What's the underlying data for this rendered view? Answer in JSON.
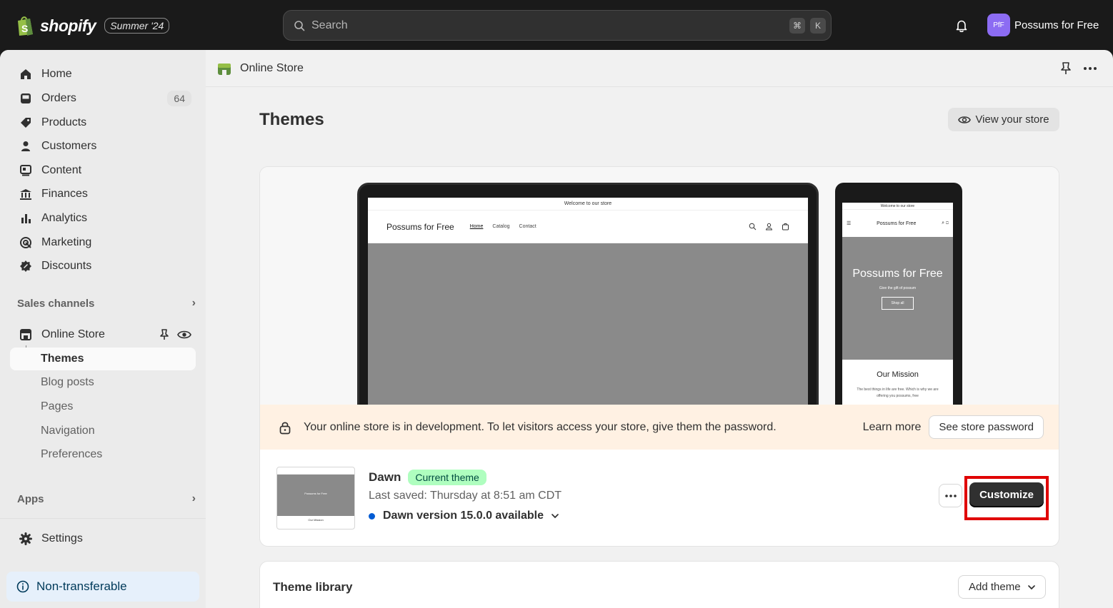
{
  "topbar": {
    "logo_text": "shopify",
    "edition": "Summer '24",
    "search_placeholder": "Search",
    "shortcut_cmd": "⌘",
    "shortcut_key": "K",
    "avatar_initials": "PfF",
    "store_name": "Possums for Free"
  },
  "sidebar": {
    "items": [
      {
        "label": "Home",
        "icon": "home-icon"
      },
      {
        "label": "Orders",
        "icon": "orders-icon",
        "badge": "64"
      },
      {
        "label": "Products",
        "icon": "tag-icon"
      },
      {
        "label": "Customers",
        "icon": "person-icon"
      },
      {
        "label": "Content",
        "icon": "content-icon"
      },
      {
        "label": "Finances",
        "icon": "bank-icon"
      },
      {
        "label": "Analytics",
        "icon": "bar-chart-icon"
      },
      {
        "label": "Marketing",
        "icon": "target-icon"
      },
      {
        "label": "Discounts",
        "icon": "discount-icon"
      }
    ],
    "sales_channels_label": "Sales channels",
    "online_store_label": "Online Store",
    "sub_items": [
      "Themes",
      "Blog posts",
      "Pages",
      "Navigation",
      "Preferences"
    ],
    "apps_label": "Apps",
    "settings_label": "Settings",
    "non_transferable": "Non-transferable"
  },
  "breadcrumb": {
    "label": "Online Store"
  },
  "page": {
    "title": "Themes",
    "view_store": "View your store"
  },
  "preview": {
    "announcement": "Welcome to our store",
    "store_name": "Possums for Free",
    "nav": [
      "Home",
      "Catalog",
      "Contact"
    ],
    "hero_title": "Possums for Free",
    "hero_sub": "Give the gift of possum",
    "hero_button": "Shop all",
    "mission_title": "Our Mission",
    "mission_text": "The best things in life are free. Which is why we are offering you possums, free"
  },
  "banner": {
    "text": "Your online store is in development. To let visitors access your store, give them the password.",
    "learn_more": "Learn more",
    "password_button": "See store password"
  },
  "current_theme": {
    "name": "Dawn",
    "badge": "Current theme",
    "last_saved": "Last saved: Thursday at 8:51 am CDT",
    "version": "Dawn version 15.0.0 available",
    "customize": "Customize",
    "thumb_title": "Possums for Free",
    "thumb_mission": "Our Mission"
  },
  "library": {
    "title": "Theme library",
    "add_theme": "Add theme"
  },
  "colors": {
    "topbar": "#1a1a1a",
    "accent_badge": "#affebf",
    "highlight": "#e00000",
    "info_dot": "#005bd3"
  }
}
